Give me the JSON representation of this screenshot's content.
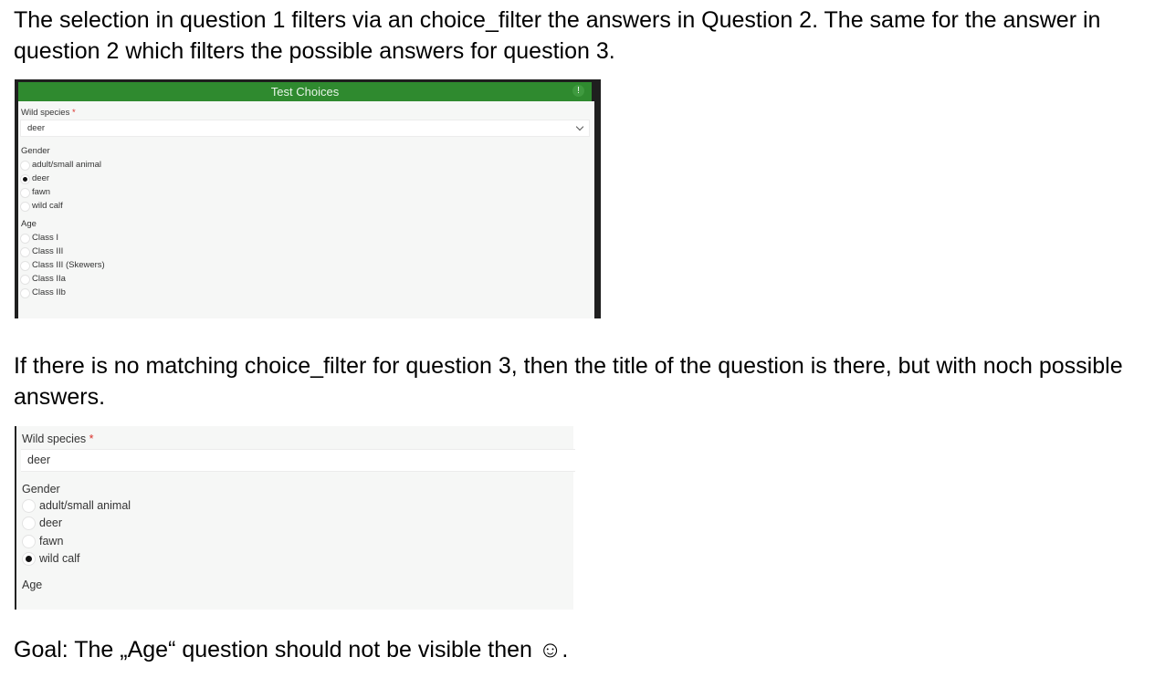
{
  "paragraph1": "The selection in question 1 filters via an choice_filter the answers in Question 2. The same for the answer in question 2 which filters the possible answers for question 3.",
  "paragraph2": "If there is no matching choice_filter for question 3, then the title of the question is there, but with noch possible answers.",
  "paragraph3": "Goal: The „Age“ question should not be visible then ☺.",
  "screenshot1": {
    "form_title": "Test Choices",
    "alert_icon": "!",
    "q1": {
      "label": "Wild species",
      "required_mark": "*",
      "value": "deer"
    },
    "q2": {
      "label": "Gender",
      "options": [
        {
          "label": "adult/small animal",
          "selected": false
        },
        {
          "label": "deer",
          "selected": true
        },
        {
          "label": "fawn",
          "selected": false
        },
        {
          "label": "wild calf",
          "selected": false
        }
      ]
    },
    "q3": {
      "label": "Age",
      "options": [
        {
          "label": "Class I",
          "selected": false
        },
        {
          "label": "Class III",
          "selected": false
        },
        {
          "label": "Class III (Skewers)",
          "selected": false
        },
        {
          "label": "Class IIa",
          "selected": false
        },
        {
          "label": "Class IIb",
          "selected": false
        }
      ]
    }
  },
  "screenshot2": {
    "q1": {
      "label": "Wild species",
      "required_mark": "*",
      "value": "deer"
    },
    "q2": {
      "label": "Gender",
      "options": [
        {
          "label": "adult/small animal",
          "selected": false
        },
        {
          "label": "deer",
          "selected": false
        },
        {
          "label": "fawn",
          "selected": false
        },
        {
          "label": "wild calf",
          "selected": true
        }
      ]
    },
    "q3": {
      "label": "Age"
    }
  }
}
